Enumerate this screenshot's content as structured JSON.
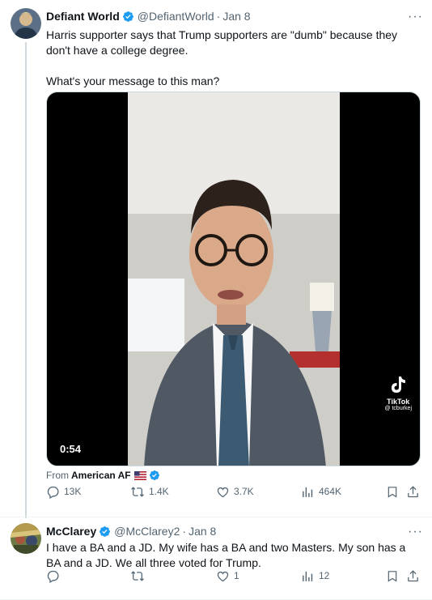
{
  "post1": {
    "display_name": "Defiant World",
    "handle": "@DefiantWorld",
    "separator": "·",
    "time": "Jan 8",
    "more_label": "···",
    "text": "Harris supporter says that Trump supporters are \"dumb\" because they don't have a college degree.\n\nWhat's your message to this man?",
    "video": {
      "duration": "0:54",
      "watermark_name": "TikTok",
      "watermark_handle": "@ tcburkej"
    },
    "from_prefix": "From",
    "from_source": "American AF",
    "actions": {
      "replies": "13K",
      "reposts": "1.4K",
      "likes": "3.7K",
      "views": "464K"
    }
  },
  "post2": {
    "display_name": "McClarey",
    "handle": "@McClarey2",
    "separator": "·",
    "time": "Jan 8",
    "more_label": "···",
    "text": "I have a BA and a JD.  My wife has a BA and two Masters.  My son has a BA and a JD.  We all three voted for Trump.",
    "actions": {
      "replies": "",
      "reposts": "",
      "likes": "1",
      "views": "12"
    }
  },
  "colors": {
    "verified_blue": "#1d9bf0",
    "muted": "#536471",
    "text": "#0f1419"
  }
}
